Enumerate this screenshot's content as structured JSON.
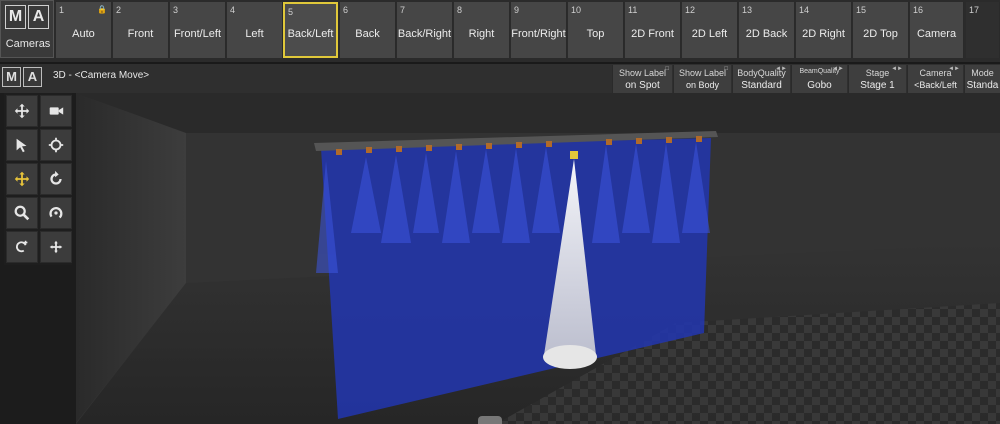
{
  "app": {
    "logo_letters": [
      "M",
      "A"
    ],
    "pool_caption": "Cameras"
  },
  "camera_buttons": [
    {
      "num": "1",
      "label": "Auto",
      "locked": true
    },
    {
      "num": "2",
      "label": "Front"
    },
    {
      "num": "3",
      "label": "Front/Left"
    },
    {
      "num": "4",
      "label": "Left"
    },
    {
      "num": "5",
      "label": "Back/Left",
      "active": true
    },
    {
      "num": "6",
      "label": "Back"
    },
    {
      "num": "7",
      "label": "Back/Right"
    },
    {
      "num": "8",
      "label": "Right"
    },
    {
      "num": "9",
      "label": "Front/Right"
    },
    {
      "num": "10",
      "label": "Top"
    },
    {
      "num": "11",
      "label": "2D Front"
    },
    {
      "num": "12",
      "label": "2D Left"
    },
    {
      "num": "13",
      "label": "2D Back"
    },
    {
      "num": "14",
      "label": "2D Right"
    },
    {
      "num": "15",
      "label": "2D Top"
    },
    {
      "num": "16",
      "label": "Camera"
    },
    {
      "num": "17",
      "label": ""
    }
  ],
  "view": {
    "title": "3D - <Camera Move>",
    "options": [
      {
        "line1": "Show Label",
        "line2": "on Spot"
      },
      {
        "line1": "Show Label",
        "line2": "on Body"
      },
      {
        "line1": "BodyQuality",
        "line2": "Standard"
      },
      {
        "line1": "BeamQuality",
        "line2": "Gobo"
      },
      {
        "line1": "Stage",
        "line2": "Stage 1"
      },
      {
        "line1": "Camera",
        "line2": "<Back/Left"
      },
      {
        "line1": "Mode",
        "line2": "Standa"
      }
    ]
  },
  "tools": [
    {
      "name": "move-cross-icon"
    },
    {
      "name": "video-camera-icon"
    },
    {
      "name": "select-arrow-icon"
    },
    {
      "name": "crosshair-icon"
    },
    {
      "name": "pan-move-icon",
      "highlight": true
    },
    {
      "name": "rotate-icon"
    },
    {
      "name": "zoom-icon"
    },
    {
      "name": "orbit-icon"
    },
    {
      "name": "rotate-move-icon"
    },
    {
      "name": "dolly-icon"
    }
  ],
  "colors": {
    "beam_blue": "#2a3fc0",
    "spot_white": "#f0f0f0",
    "active_border": "#e0c83a"
  }
}
